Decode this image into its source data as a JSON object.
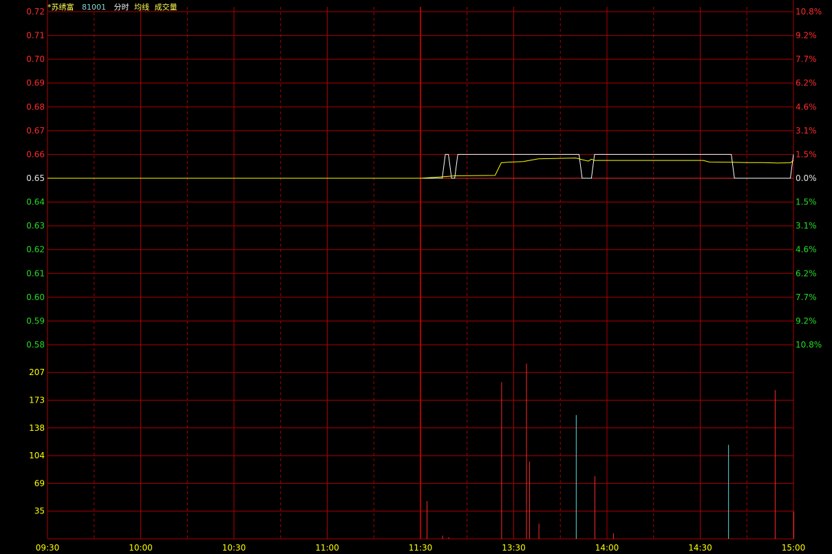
{
  "header": {
    "name": "*苏绣富",
    "code": "81001",
    "mode": "分时",
    "avg_label": "均线",
    "volume_label": "成交量"
  },
  "colors": {
    "background": "#000000",
    "grid": "#b00000",
    "up": "#ff2a2a",
    "down": "#22dd22",
    "neutral": "#e6e6e6",
    "price_line": "#ffffff",
    "avg_line": "#ffff00",
    "volume_up": "#ff2a2a",
    "volume_down": "#55dddd",
    "volume_label": "#ffff00",
    "time_label": "#ffff00"
  },
  "chart_data": {
    "type": "line",
    "prev_close": 0.65,
    "price_axis": {
      "ticks": [
        "0.72",
        "0.71",
        "0.70",
        "0.69",
        "0.68",
        "0.67",
        "0.66",
        "0.65",
        "0.64",
        "0.63",
        "0.62",
        "0.61",
        "0.60",
        "0.59",
        "0.58"
      ],
      "ylim": [
        0.58,
        0.72
      ]
    },
    "pct_axis": {
      "ticks": [
        "10.8%",
        "9.2%",
        "7.7%",
        "6.2%",
        "4.6%",
        "3.1%",
        "1.5%",
        "0.0%",
        "1.5%",
        "3.1%",
        "4.6%",
        "6.2%",
        "7.7%",
        "9.2%",
        "10.8%"
      ]
    },
    "volume_axis": {
      "ticks": [
        "207",
        "173",
        "138",
        "104",
        "69",
        "35"
      ],
      "ylim": [
        0,
        240
      ]
    },
    "time_axis": {
      "labels": [
        "09:30",
        "10:00",
        "10:30",
        "11:00",
        "11:30",
        "13:30",
        "14:00",
        "14:30",
        "15:00"
      ],
      "session_minutes": 240
    },
    "series": [
      {
        "x": [
          0,
          120,
          127,
          128,
          129,
          130,
          131,
          132,
          133,
          134,
          135,
          136,
          137,
          138,
          139,
          140,
          141,
          142,
          143,
          144,
          145,
          146,
          147,
          148,
          149,
          150,
          151,
          152,
          153,
          154,
          155,
          156,
          157,
          158,
          159,
          160,
          161,
          162,
          163,
          164,
          165,
          166,
          167,
          168,
          169,
          170,
          171,
          172,
          173,
          174,
          175,
          176,
          177,
          178,
          179,
          180,
          181,
          182,
          183,
          184,
          185,
          186,
          187,
          188,
          189,
          190,
          191,
          192,
          193,
          194,
          195,
          196,
          197,
          198,
          199,
          200,
          201,
          202,
          203,
          204,
          205,
          206,
          207,
          208,
          209,
          210,
          211,
          212,
          213,
          214,
          215,
          216,
          217,
          218,
          219,
          220,
          221,
          222,
          223,
          224,
          225,
          226,
          227,
          228,
          229,
          230,
          231,
          232,
          233,
          234,
          235,
          236,
          237,
          238,
          239,
          240
        ],
        "values": [
          0.65,
          0.65,
          0.65,
          0.66,
          0.66,
          0.65,
          0.65,
          0.66,
          0.66,
          0.66,
          0.66,
          0.66,
          0.66,
          0.66,
          0.66,
          0.66,
          0.66,
          0.66,
          0.66,
          0.66,
          0.66,
          0.66,
          0.66,
          0.66,
          0.66,
          0.66,
          0.66,
          0.66,
          0.66,
          0.66,
          0.66,
          0.66,
          0.66,
          0.66,
          0.66,
          0.66,
          0.66,
          0.66,
          0.66,
          0.66,
          0.66,
          0.66,
          0.66,
          0.66,
          0.66,
          0.66,
          0.66,
          0.65,
          0.65,
          0.65,
          0.65,
          0.66,
          0.66,
          0.66,
          0.66,
          0.66,
          0.66,
          0.66,
          0.66,
          0.66,
          0.66,
          0.66,
          0.66,
          0.66,
          0.66,
          0.66,
          0.66,
          0.66,
          0.66,
          0.66,
          0.66,
          0.66,
          0.66,
          0.66,
          0.66,
          0.66,
          0.66,
          0.66,
          0.66,
          0.66,
          0.66,
          0.66,
          0.66,
          0.66,
          0.66,
          0.66,
          0.66,
          0.66,
          0.66,
          0.66,
          0.66,
          0.66,
          0.66,
          0.66,
          0.66,
          0.66,
          0.65,
          0.65,
          0.65,
          0.65,
          0.65,
          0.65,
          0.65,
          0.65,
          0.65,
          0.65,
          0.65,
          0.65,
          0.65,
          0.65,
          0.65,
          0.65,
          0.65,
          0.65,
          0.65,
          0.66
        ]
      },
      {
        "x": [
          0,
          120,
          126,
          129,
          131,
          144,
          146,
          148,
          153,
          158,
          170,
          172,
          174,
          175,
          176,
          180,
          200,
          211,
          213,
          220,
          225,
          230,
          235,
          239,
          240
        ],
        "values": [
          0.65,
          0.65,
          0.6505,
          0.6508,
          0.651,
          0.6512,
          0.6565,
          0.6567,
          0.657,
          0.6582,
          0.6585,
          0.6578,
          0.6572,
          0.658,
          0.6575,
          0.6575,
          0.6575,
          0.6575,
          0.6568,
          0.6567,
          0.6566,
          0.6566,
          0.6564,
          0.6565,
          0.6575
        ]
      }
    ],
    "volume": {
      "x": [
        122,
        127,
        129,
        146,
        154,
        155,
        158,
        170,
        176,
        182,
        219,
        234,
        240
      ],
      "values": [
        47,
        4,
        2,
        195,
        218,
        96,
        19,
        154,
        78,
        7,
        117,
        185,
        34
      ],
      "direction": [
        "up",
        "up",
        "up",
        "up",
        "up",
        "up",
        "up",
        "down",
        "up",
        "up",
        "down",
        "up",
        "up"
      ]
    }
  }
}
